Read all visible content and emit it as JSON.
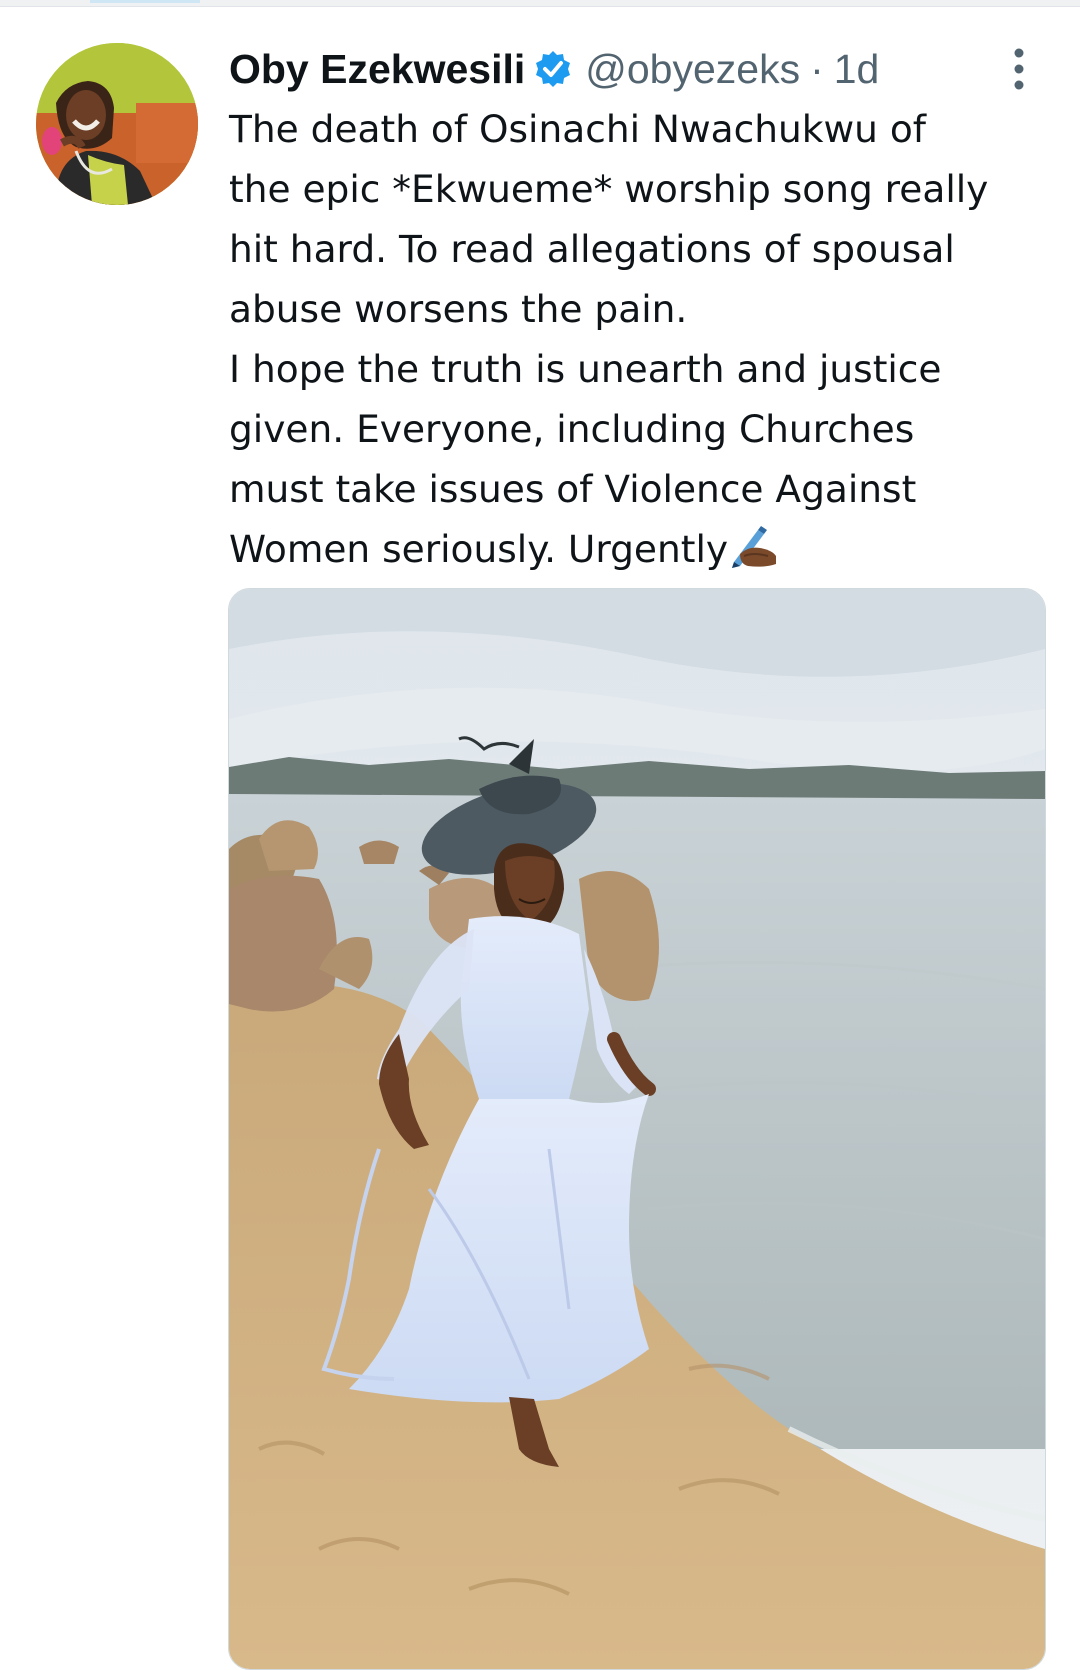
{
  "tweet": {
    "author": {
      "display_name": "Oby Ezekwesili",
      "handle": "@obyezeks",
      "verified": true,
      "avatar": "profile-photo"
    },
    "separator": "·",
    "time": "1d",
    "text_lines": [
      "The death of Osinachi Nwachukwu of",
      "the epic *Ekwueme* worship song really",
      "hit hard. To read allegations of spousal",
      "abuse worsens the pain.",
      "I hope the truth is unearth and justice",
      "given. Everyone, including Churches",
      "must take issues of Violence Against",
      "Women seriously. Urgently"
    ],
    "trailing_emoji": "writing-hand-emoji",
    "media": {
      "type": "photo",
      "description_icon": "beach-photo"
    }
  },
  "colors": {
    "text": "#0f1419",
    "secondary": "#536471",
    "verified_blue": "#1d9bf0",
    "media_border": "#cfd9de"
  },
  "icons": [
    "verified-badge-icon",
    "more-options-icon",
    "writing-hand-emoji"
  ]
}
